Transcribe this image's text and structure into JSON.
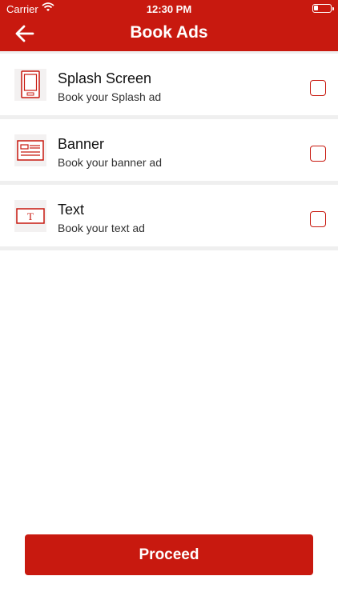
{
  "status_bar": {
    "carrier": "Carrier",
    "time": "12:30 PM"
  },
  "header": {
    "title": "Book Ads",
    "back_icon": "arrow-left-icon"
  },
  "colors": {
    "accent": "#c8190f",
    "separator": "#efefef"
  },
  "items": [
    {
      "title": "Splash Screen",
      "subtitle": "Book your Splash ad",
      "icon": "tablet-icon",
      "checked": false
    },
    {
      "title": "Banner",
      "subtitle": "Book your banner ad",
      "icon": "banner-icon",
      "checked": false
    },
    {
      "title": "Text",
      "subtitle": "Book your text ad",
      "icon": "text-ad-icon",
      "icon_glyph": "T",
      "checked": false
    }
  ],
  "footer": {
    "proceed_label": "Proceed"
  }
}
